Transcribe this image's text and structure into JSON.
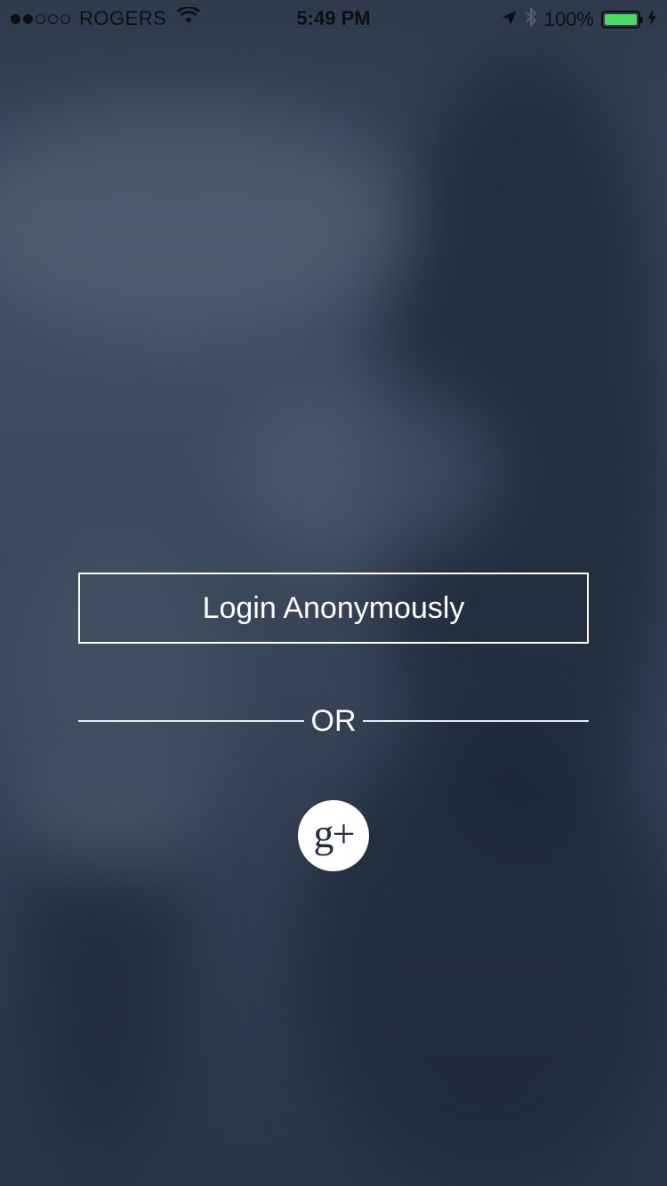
{
  "status_bar": {
    "signal_strength": "2 of 5 bars",
    "carrier": "ROGERS",
    "time": "5:49 PM",
    "battery": "100%",
    "battery_color": "#4cd964"
  },
  "login": {
    "anonymous_label": "Login Anonymously",
    "divider_text": "OR",
    "google_plus_glyph": "g+"
  },
  "icons": {
    "wifi": "wifi-icon",
    "location": "location-arrow-icon",
    "bluetooth": "bluetooth-icon",
    "charging": "bolt-icon",
    "google_plus": "google-plus-icon"
  }
}
